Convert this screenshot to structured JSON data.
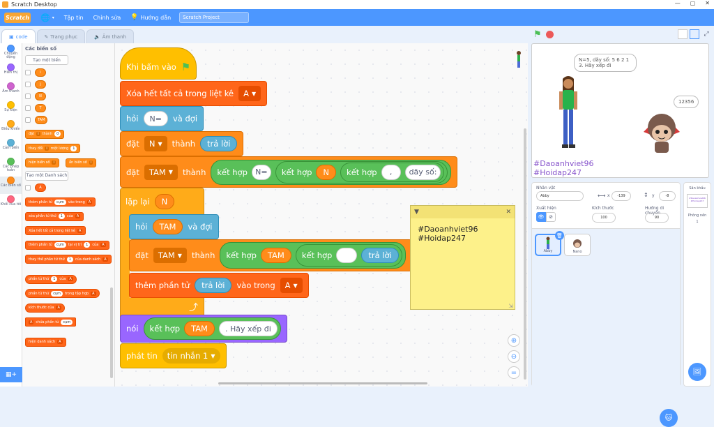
{
  "window": {
    "title": "Scratch Desktop",
    "min": "—",
    "max": "▢",
    "close": "✕"
  },
  "menubar": {
    "logo": "Scratch",
    "file": "Tập tin",
    "edit": "Chỉnh sửa",
    "tutorials": "Hướng dẫn",
    "project_title": "Scratch Project"
  },
  "tabs": {
    "code": "code",
    "costumes": "Trang phục",
    "sounds": "Âm thanh"
  },
  "categories": [
    {
      "label": "Chuyển động",
      "color": "#4c97ff"
    },
    {
      "label": "Hiển thị",
      "color": "#9966ff"
    },
    {
      "label": "Âm thanh",
      "color": "#cf63cf"
    },
    {
      "label": "Sự kiện",
      "color": "#ffbf00"
    },
    {
      "label": "Điều khiển",
      "color": "#ffab19"
    },
    {
      "label": "Cảm biến",
      "color": "#5cb1d6"
    },
    {
      "label": "Các phép toán",
      "color": "#59c059"
    },
    {
      "label": "Các biến số",
      "color": "#ff8c1a"
    },
    {
      "label": "Khối của tôi",
      "color": "#ff6680"
    }
  ],
  "palette": {
    "title": "Các biến số",
    "make_var": "Tạo một biến",
    "vars": [
      "i",
      "j",
      "N",
      "T",
      "TAM"
    ],
    "set_lbl": "đặt",
    "set_var": "i",
    "set_to": "thành",
    "set_val": "0",
    "change_lbl": "thay đổi",
    "change_var": "i",
    "change_by": "một lượng",
    "change_val": "1",
    "show_var": "hiện biến số",
    "show_var_name": "i",
    "hide_var": "ẩn biến số",
    "hide_var_name": "i",
    "make_list": "Tạo một Danh sách",
    "list_name": "A",
    "add_item": "thêm phần tử",
    "add_item_val": "cụm",
    "add_item_to": "vào trong",
    "add_item_list": "A",
    "del_item": "xóa phần tử thứ",
    "del_item_val": "1",
    "del_item_of": "của",
    "del_item_list": "A",
    "del_all": "Xóa hết tất cả trong liệt kê",
    "del_all_list": "A",
    "insert": "thêm phần tử",
    "insert_val": "cụm",
    "insert_at": "tại vị trí",
    "insert_idx": "1",
    "insert_of": "của",
    "insert_list": "A",
    "replace": "thay thế phần tử thứ",
    "replace_idx": "1",
    "replace_of": "của danh sách",
    "replace_list": "A",
    "item": "phần tử thứ",
    "item_idx": "1",
    "item_of": "của",
    "item_list": "A",
    "item_num": "phần tử thứ",
    "item_num_val": "cụm",
    "item_num_in": "trong tập hợp",
    "item_num_list": "A",
    "length": "kích thước của",
    "length_list": "A",
    "contains_list": "A",
    "contains": "chứa phần tử",
    "contains_val": "cụm",
    "show_list": "hiện danh sách",
    "show_list_name": "A"
  },
  "script": {
    "hat": "Khi bấm vào",
    "del_all": "Xóa hết tất cả trong liệt kê",
    "del_all_list": "A",
    "ask1": "hỏi",
    "ask1_val": "N=",
    "ask1_wait": "và đợi",
    "set1": "đặt",
    "set1_var": "N",
    "set1_to": "thành",
    "set1_answer": "trả lời",
    "set2": "đặt",
    "set2_var": "TAM",
    "set2_to": "thành",
    "join": "kết hợp",
    "join1_a": "N=",
    "join2_var": "N",
    "join3_a": ",",
    "join3_b": "dãy số:",
    "repeat": "lặp lại",
    "repeat_var": "N",
    "ask2": "hỏi",
    "ask2_var": "TAM",
    "ask2_wait": "và đợi",
    "set3": "đặt",
    "set3_var": "TAM",
    "set3_to": "thành",
    "set3_a": "TAM",
    "set3_b": "",
    "set3_answer": "trả lời",
    "add": "thêm phần tử",
    "add_answer": "trả lời",
    "add_in": "vào trong",
    "add_list": "A",
    "say": "nói",
    "say_var": "TAM",
    "say_text": ". Hãy xếp đi",
    "broadcast": "phát tin",
    "broadcast_msg": "tin nhắn 1"
  },
  "note": {
    "line1": "#Daoanhviet96",
    "line2": "#Hoidap247"
  },
  "stage": {
    "bubble1": "N=5, dãy số: 5 6 2 1 3. Hãy xếp đi",
    "bubble2": "12356",
    "tag1": "#Daoanhviet96",
    "tag2": "#Hoidap247"
  },
  "sprite_info": {
    "sprite_lbl": "Nhân vật",
    "sprite_name": "Abby",
    "x_lbl": "x",
    "x_val": "-139",
    "y_lbl": "y",
    "y_val": "-8",
    "show_lbl": "Xuất hiện",
    "size_lbl": "Kích thước",
    "size_val": "100",
    "dir_lbl": "Hướng di chuyển",
    "dir_val": "90"
  },
  "sprites": [
    {
      "name": "Abby"
    },
    {
      "name": "Nano"
    }
  ],
  "stage_pane": {
    "title": "Sân khấu",
    "backdrops_lbl": "Phông nền",
    "backdrops_count": "1"
  }
}
